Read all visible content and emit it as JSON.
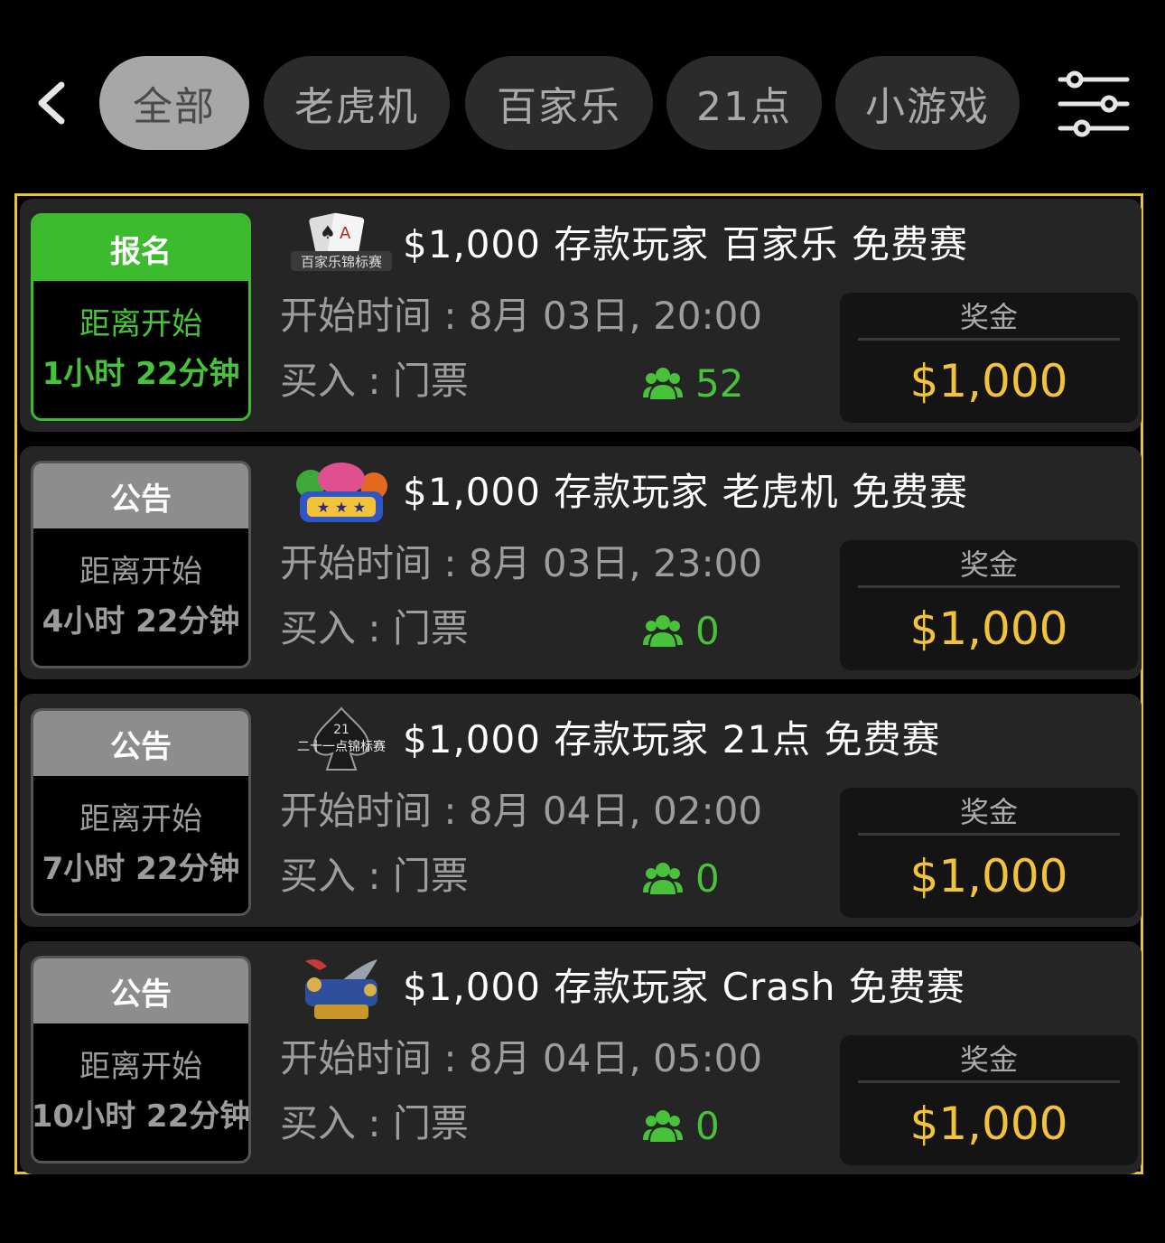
{
  "tabs": [
    {
      "label": "全部",
      "active": true
    },
    {
      "label": "老虎机",
      "active": false
    },
    {
      "label": "百家乐",
      "active": false
    },
    {
      "label": "21点",
      "active": false
    },
    {
      "label": "小游戏",
      "active": false
    }
  ],
  "colors": {
    "accent_yellow": "#e7c43a",
    "green": "#3dbb2f",
    "prize_gold": "#f2c33a"
  },
  "tournaments": [
    {
      "status_label": "报名",
      "countdown_label": "距离开始",
      "countdown": "1小时 22分钟",
      "logo_text": "百家乐锦标赛",
      "title": "$1,000 存款玩家 百家乐 免费赛",
      "start_time": "开始时间 : 8月 03日, 20:00",
      "buy_in": "买入 : 门票",
      "players": "52",
      "prize_label": "奖金",
      "prize_value": "$1,000"
    },
    {
      "status_label": "公告",
      "countdown_label": "距离开始",
      "countdown": "4小时 22分钟",
      "logo_text": "",
      "title": "$1,000 存款玩家 老虎机 免费赛",
      "start_time": "开始时间 : 8月 03日, 23:00",
      "buy_in": "买入 : 门票",
      "players": "0",
      "prize_label": "奖金",
      "prize_value": "$1,000"
    },
    {
      "status_label": "公告",
      "countdown_label": "距离开始",
      "countdown": "7小时 22分钟",
      "logo_text": "二十一点锦标赛",
      "title": "$1,000 存款玩家 21点 免费赛",
      "start_time": "开始时间 : 8月 04日, 02:00",
      "buy_in": "买入 : 门票",
      "players": "0",
      "prize_label": "奖金",
      "prize_value": "$1,000"
    },
    {
      "status_label": "公告",
      "countdown_label": "距离开始",
      "countdown": "10小时 22分钟",
      "logo_text": "",
      "title": "$1,000 存款玩家 Crash 免费赛",
      "start_time": "开始时间 : 8月 04日, 05:00",
      "buy_in": "买入 : 门票",
      "players": "0",
      "prize_label": "奖金",
      "prize_value": "$1,000"
    }
  ]
}
